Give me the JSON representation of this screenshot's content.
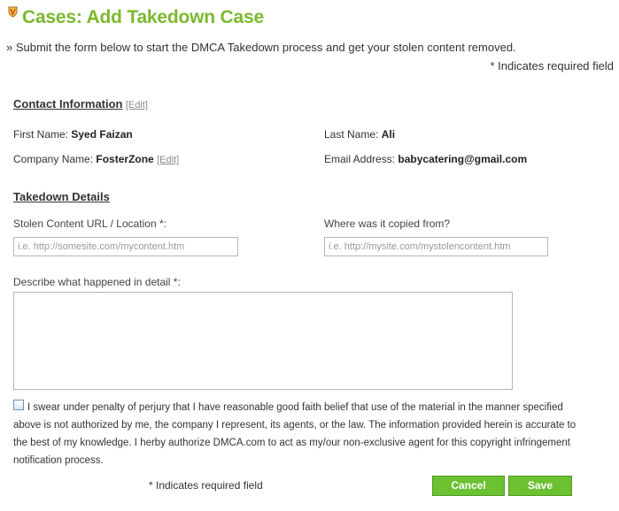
{
  "page": {
    "title": "Cases: Add Takedown Case",
    "intro": "» Submit the form below to start the DMCA Takedown process and get your stolen content removed.",
    "required_note": "*   Indicates required field"
  },
  "contact": {
    "heading": "Contact Information",
    "edit_label": "[Edit]",
    "first_name_label": "First Name:",
    "first_name_value": "Syed Faizan",
    "last_name_label": "Last Name:",
    "last_name_value": "Ali",
    "company_label": "Company Name:",
    "company_value": "FosterZone",
    "company_edit_label": "[Edit]",
    "email_label": "Email Address:",
    "email_value": "babycatering@gmail.com"
  },
  "takedown": {
    "heading": "Takedown Details",
    "stolen_url_label": "Stolen Content URL / Location *:",
    "stolen_url_placeholder": "i.e. http://somesite.com/mycontent.htm",
    "copied_from_label": "Where was it copied from?",
    "copied_from_placeholder": "i.e. http://mysite.com/mystolencontent.htm",
    "describe_label": "Describe what happened in detail *:",
    "describe_value": ""
  },
  "affirmation": {
    "checked": false,
    "text": "I swear under penalty of perjury that I have reasonable good faith belief that use of the material in the manner specified above is not authorized by me, the company I represent, its agents, or the law. The information provided herein is accurate to the best of my knowledge. I herby authorize DMCA.com to act as my/our non-exclusive agent for this copyright infringement notification process."
  },
  "footer": {
    "required_note": "* Indicates required field",
    "cancel_label": "Cancel",
    "save_label": "Save"
  },
  "colors": {
    "title_green": "#7cb82f",
    "button_green": "#6cc131",
    "shield_icon": "shield-icon"
  }
}
